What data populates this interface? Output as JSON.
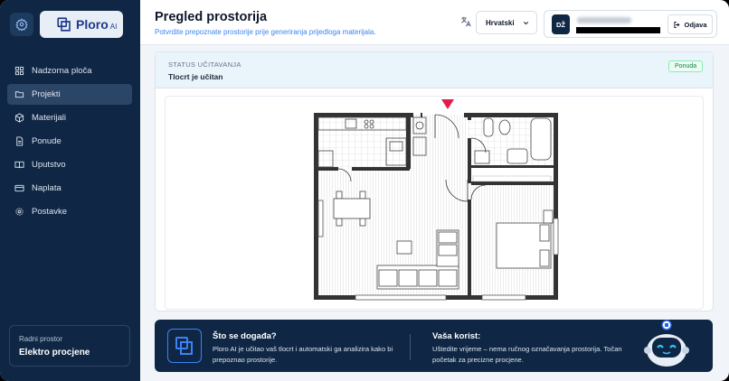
{
  "sidebar": {
    "brand": "Ploro",
    "brand_suffix": "AI",
    "items": [
      {
        "label": "Nadzorna ploča",
        "icon": "dashboard-icon",
        "active": false
      },
      {
        "label": "Projekti",
        "icon": "folder-icon",
        "active": true
      },
      {
        "label": "Materijali",
        "icon": "cube-icon",
        "active": false
      },
      {
        "label": "Ponude",
        "icon": "document-icon",
        "active": false
      },
      {
        "label": "Uputstvo",
        "icon": "book-icon",
        "active": false
      },
      {
        "label": "Naplata",
        "icon": "credit-card-icon",
        "active": false
      },
      {
        "label": "Postavke",
        "icon": "gear-icon",
        "active": false
      }
    ],
    "workspace": {
      "label": "Radni prostor",
      "name": "Elektro procjene"
    }
  },
  "header": {
    "title": "Pregled prostorija",
    "subtitle": "Potvrdite prepoznate prostorije prije generiranja prijedloga materijala.",
    "language": "Hrvatski",
    "avatar_initials": "DŽ",
    "logout_label": "Odjava"
  },
  "status": {
    "label": "STATUS UČITAVANJA",
    "value": "Tlocrt je učitan",
    "badge": "Ponuda"
  },
  "info": {
    "what_title": "Što se događa?",
    "what_text": "Ploro AI je učitao vaš tlocrt i automatski ga analizira kako bi prepoznao prostorije.",
    "gain_title": "Vaša korist:",
    "gain_text": "Uštedite vrijeme – nema ručnog označavanja prostorija. Točan početak za precizne procjene."
  },
  "colors": {
    "sidebar_bg": "#0f2744",
    "accent": "#3b82f6",
    "badge_green": "#15803d",
    "marker_red": "#e11d48"
  }
}
